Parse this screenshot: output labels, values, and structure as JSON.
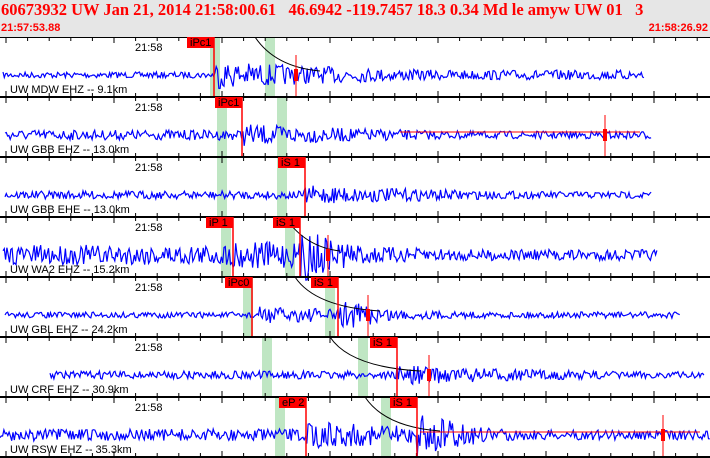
{
  "header": {
    "title": "60673932 UW Jan 21, 2014 21:58:00.61   46.6942 -119.7457 18.3 0.34 Md le amyw UW 01   3",
    "start_time": "21:57:53.88",
    "end_time": "21:58:26.92"
  },
  "colors": {
    "trace": "#0000ff",
    "pick": "#ff0000",
    "window": "#bfe6c3",
    "curve": "#000000",
    "header_text": "#ff0000"
  },
  "panels": [
    {
      "time_label": "21:58",
      "station": "UW MDW EHZ -- 9.1km",
      "picks": [
        {
          "label": "iPc1"
        }
      ]
    },
    {
      "time_label": "21:58",
      "station": "UW GBB EHZ -- 13.0km",
      "picks": [
        {
          "label": "iPc1"
        }
      ]
    },
    {
      "time_label": "21:58",
      "station": "UW GBB EHE -- 13.0km",
      "picks": [
        {
          "label": "iS 1"
        }
      ]
    },
    {
      "time_label": "21:58",
      "station": "UW WA2 EHZ -- 15.2km",
      "picks": [
        {
          "label": "iP 1"
        },
        {
          "label": "iS 1"
        }
      ]
    },
    {
      "time_label": "21:58",
      "station": "UW GBL EHZ -- 24.2km",
      "picks": [
        {
          "label": "iPc0"
        },
        {
          "label": "iS 1"
        }
      ]
    },
    {
      "time_label": "21:58",
      "station": "UW CRF EHZ -- 30.9km",
      "picks": [
        {
          "label": "iS 1"
        }
      ]
    },
    {
      "time_label": "21:58",
      "station": "UW RSW EHZ -- 35.3km",
      "picks": [
        {
          "label": "eP 2"
        },
        {
          "label": "iS 1"
        }
      ]
    }
  ]
}
